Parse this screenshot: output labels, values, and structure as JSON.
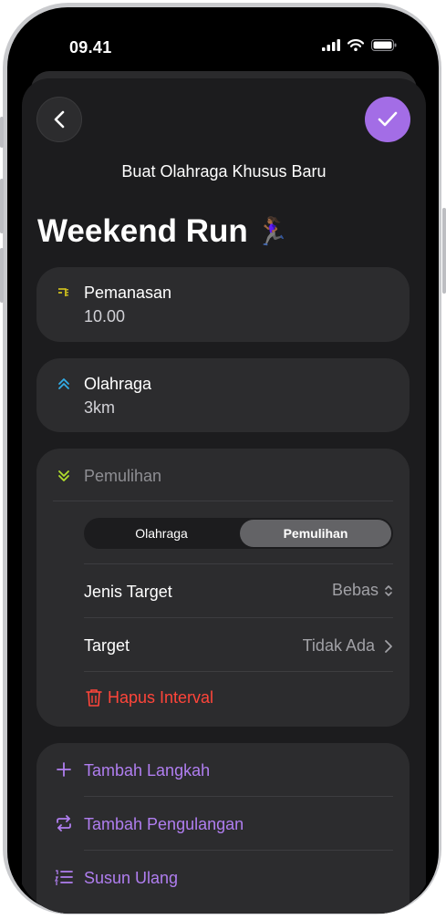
{
  "status_bar": {
    "time": "09.41"
  },
  "header": {
    "back_icon": "chevron-left-icon",
    "done_icon": "checkmark-icon",
    "subtitle": "Buat Olahraga Khusus Baru",
    "title": "Weekend Run",
    "title_emoji": "🏃🏾‍♀️",
    "accent": "#a36de6"
  },
  "warmup": {
    "label": "Pemanasan",
    "value": "10.00",
    "icon": "warmup-icon",
    "icon_color": "#e3d21b"
  },
  "workout": {
    "label": "Olahraga",
    "value": "3km",
    "icon": "double-chevron-up-icon",
    "icon_color": "#32ade6"
  },
  "cooldown": {
    "label": "Pemulihan",
    "icon": "double-chevron-down-icon",
    "icon_color": "#b2e02c",
    "segments": [
      "Olahraga",
      "Pemulihan"
    ],
    "selected_segment": "Pemulihan",
    "target_type_label": "Jenis Target",
    "target_type_value": "Bebas",
    "target_label": "Target",
    "target_value": "Tidak Ada",
    "delete_label": "Hapus Interval"
  },
  "actions": {
    "add_step": "Tambah Langkah",
    "add_repeat": "Tambah Pengulangan",
    "reorder": "Susun Ulang"
  }
}
